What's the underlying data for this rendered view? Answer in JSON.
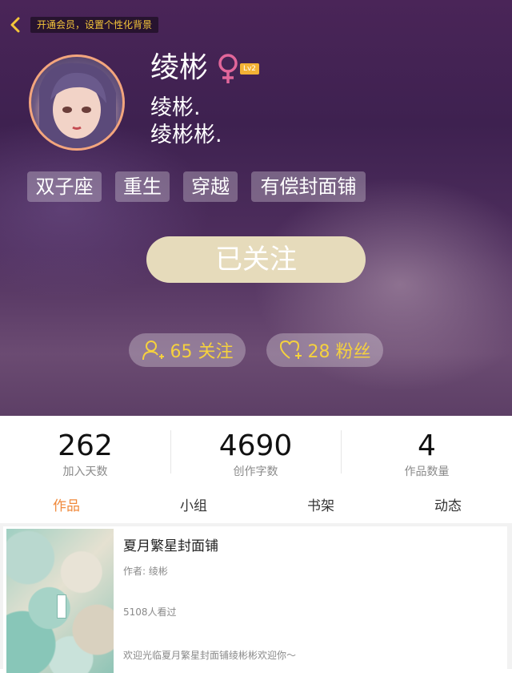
{
  "header": {
    "vip_banner": "开通会员，设置个性化背景"
  },
  "profile": {
    "username": "绫彬",
    "level": "Lv2",
    "bio_lines": [
      "绫彬.",
      "绫彬彬."
    ],
    "tags": [
      "双子座",
      "重生",
      "穿越",
      "有偿封面铺"
    ],
    "follow_button": "已关注",
    "following": "65 关注",
    "fans": "28 粉丝"
  },
  "stats": [
    {
      "value": "262",
      "label": "加入天数"
    },
    {
      "value": "4690",
      "label": "创作字数"
    },
    {
      "value": "4",
      "label": "作品数量"
    }
  ],
  "tabs": [
    {
      "label": "作品",
      "active": true
    },
    {
      "label": "小组",
      "active": false
    },
    {
      "label": "书架",
      "active": false
    },
    {
      "label": "动态",
      "active": false
    }
  ],
  "works": [
    {
      "title": "夏月繁星封面铺",
      "author": "作者: 绫彬",
      "views": "5108人看过",
      "description": "欢迎光临夏月繁星封面铺绫彬彬欢迎你～"
    }
  ],
  "colors": {
    "accent_orange": "#f08a3c",
    "vip_yellow": "#f5c53a",
    "follow_button": "#e6dbbb",
    "stat_yellow": "#f5d13e",
    "gender_pink": "#e2669a"
  },
  "icons": {
    "back": "chevron-left-icon",
    "gender": "female-icon",
    "following": "user-add-icon",
    "fans": "heart-add-icon"
  }
}
